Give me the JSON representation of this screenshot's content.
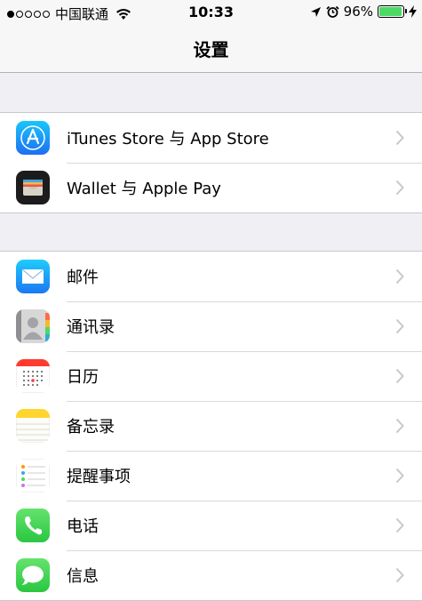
{
  "status_bar": {
    "carrier": "中国联通",
    "time": "10:33",
    "battery_percent": "96%",
    "battery_level": 0.96,
    "signal_bars_filled": 1,
    "signal_bars_total": 5
  },
  "nav": {
    "title": "设置"
  },
  "groups": [
    {
      "items": [
        {
          "label": "iTunes Store 与 App Store",
          "icon": "app-store-icon"
        },
        {
          "label": "Wallet 与 Apple Pay",
          "icon": "wallet-icon"
        }
      ]
    },
    {
      "items": [
        {
          "label": "邮件",
          "icon": "mail-icon"
        },
        {
          "label": "通讯录",
          "icon": "contacts-icon"
        },
        {
          "label": "日历",
          "icon": "calendar-icon"
        },
        {
          "label": "备忘录",
          "icon": "notes-icon"
        },
        {
          "label": "提醒事项",
          "icon": "reminders-icon"
        },
        {
          "label": "电话",
          "icon": "phone-icon"
        },
        {
          "label": "信息",
          "icon": "messages-icon"
        }
      ]
    }
  ],
  "colors": {
    "background": "#efeff4",
    "battery_fill": "#4cd964",
    "chevron": "#c7c7cc"
  }
}
